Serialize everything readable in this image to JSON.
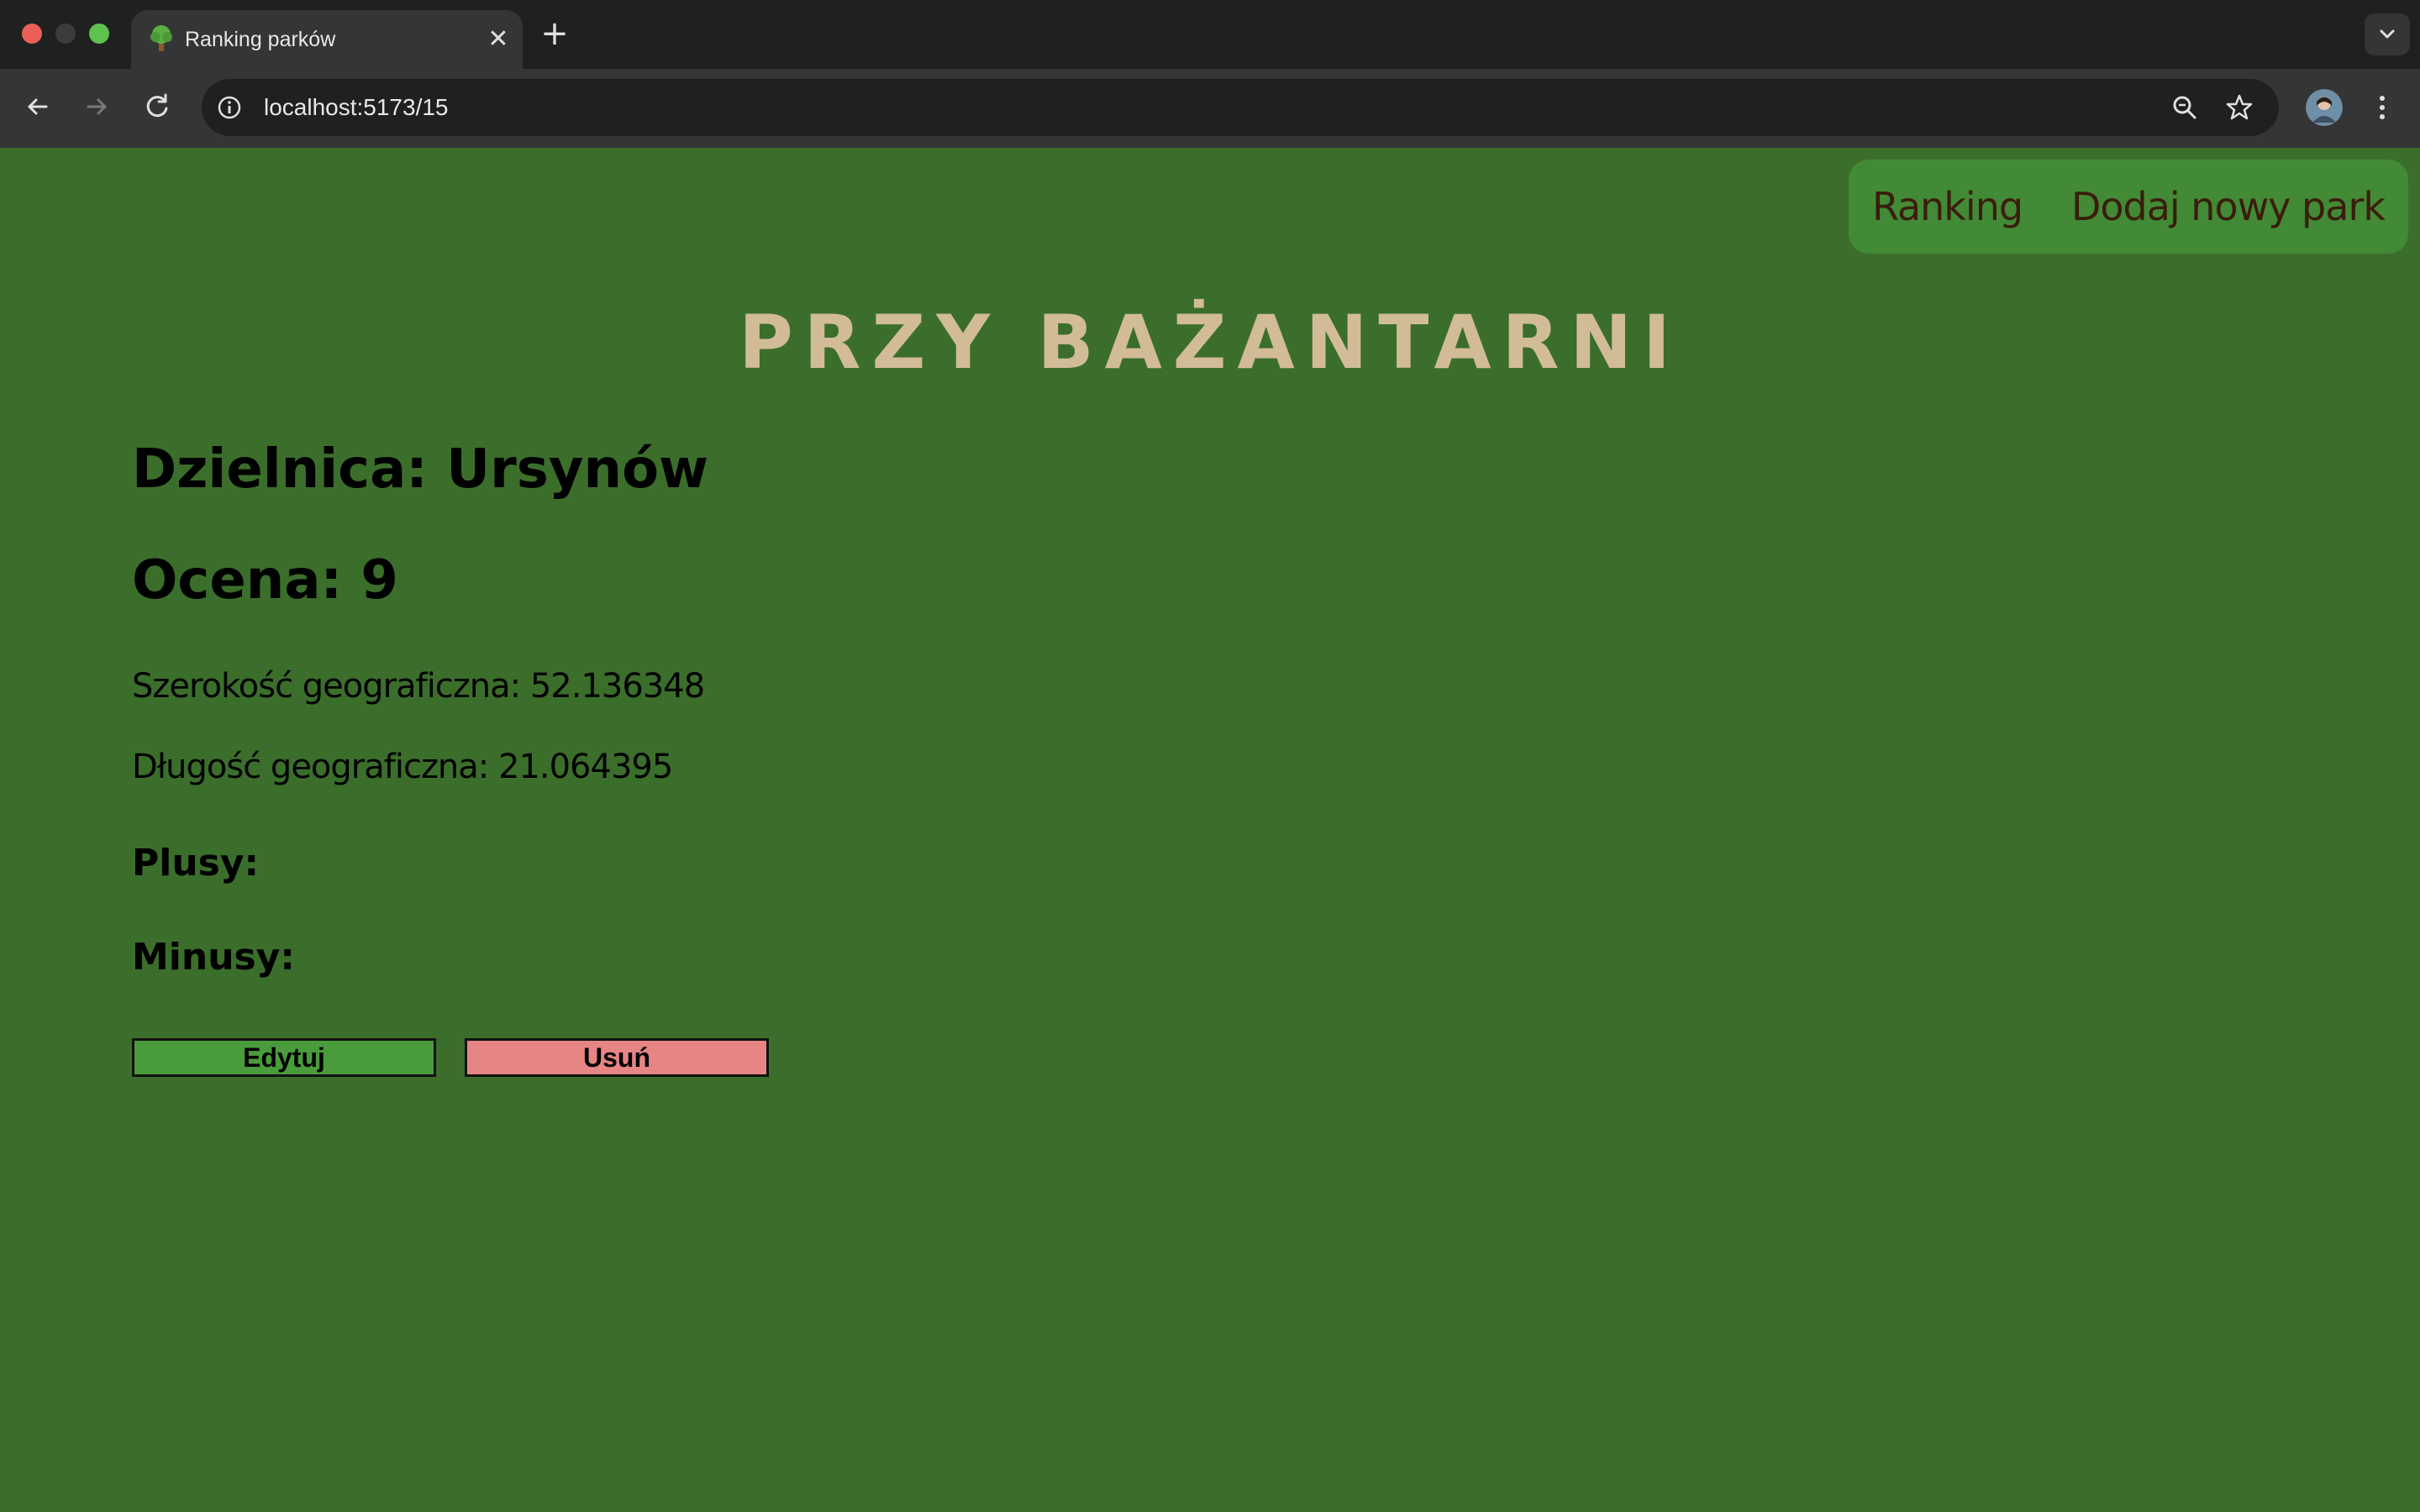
{
  "browser": {
    "tab": {
      "title": "Ranking parków",
      "favicon": "tree-icon"
    },
    "address_bar": {
      "url": "localhost:5173/15"
    }
  },
  "nav": {
    "ranking": "Ranking",
    "add_park": "Dodaj nowy park"
  },
  "park": {
    "name": "PRZY BAŻANTARNI",
    "district": "Dzielnica: Ursynów",
    "rating": "Ocena: 9",
    "latitude": "Szerokość geograficzna: 52.136348",
    "longitude": "Długość geograficzna: 21.064395",
    "pros_label": "Plusy:",
    "cons_label": "Minusy:"
  },
  "actions": {
    "edit": "Edytuj",
    "delete": "Usuń"
  },
  "colors": {
    "page_background": "#3b6e2b",
    "nav_background": "#428a35",
    "title": "#d2bc98",
    "edit_button": "#4a9b3b",
    "delete_button": "#e58584"
  }
}
